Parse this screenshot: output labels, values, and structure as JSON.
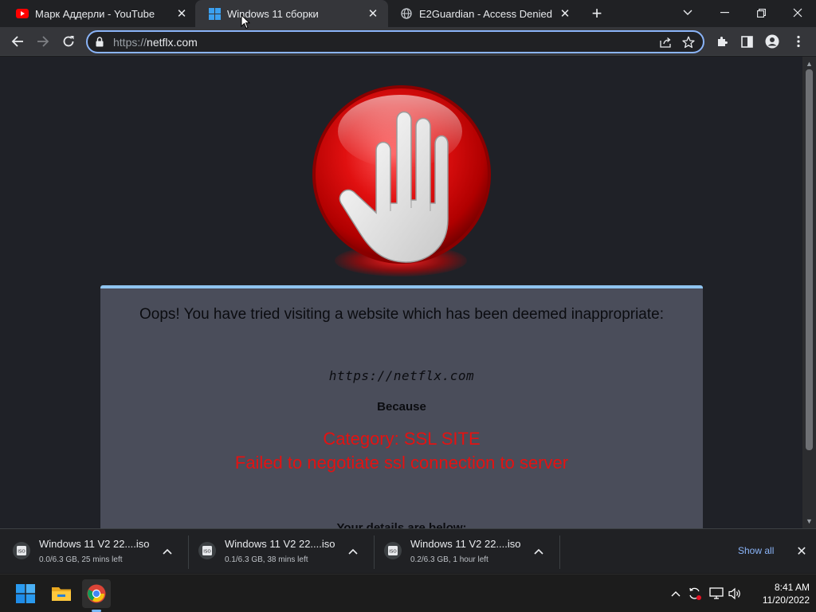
{
  "browser": {
    "tabs": [
      {
        "title": "Марк Аддерли - YouTube",
        "icon": "youtube-icon",
        "active": false
      },
      {
        "title": "Windows 11 сборки",
        "icon": "windows-icon",
        "active": true
      },
      {
        "title": "E2Guardian - Access Denied",
        "icon": "globe-icon",
        "active": false
      }
    ],
    "address": {
      "scheme": "https://",
      "host": "netflx.com"
    }
  },
  "page": {
    "headline": "Oops! You have tried visiting a website which has been deemed inappropriate:",
    "blocked_url": "https://netflx.com",
    "because_label": "Because",
    "category": "Category: SSL SITE",
    "reason": "Failed to negotiate ssl connection to server",
    "details_label": "Your details are below:",
    "colors": {
      "reason": "#e31212",
      "panel_accent": "#8fc4f0"
    }
  },
  "downloads": {
    "items": [
      {
        "name": "Windows 11 V2 22....iso",
        "status": "0.0/6.3 GB, 25 mins left"
      },
      {
        "name": "Windows 11 V2 22....iso",
        "status": "0.1/6.3 GB, 38 mins left"
      },
      {
        "name": "Windows 11 V2 22....iso",
        "status": "0.2/6.3 GB, 1 hour left"
      }
    ],
    "show_all": "Show all"
  },
  "taskbar": {
    "time": "8:41 AM",
    "date": "11/20/2022"
  }
}
